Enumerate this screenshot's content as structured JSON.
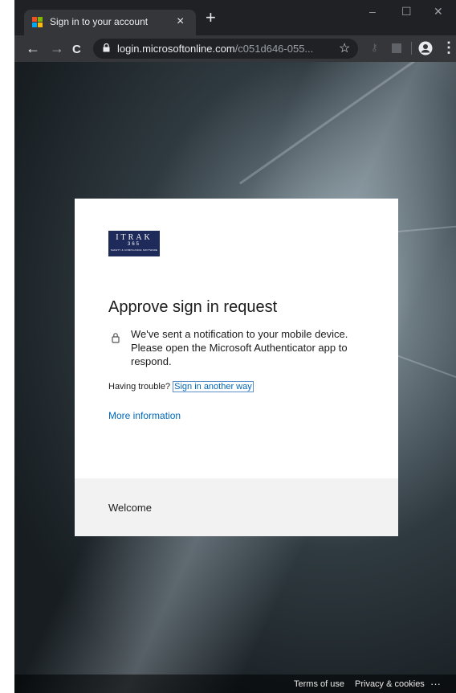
{
  "browser": {
    "tab_title": "Sign in to your account",
    "tab_close": "×",
    "new_tab": "+",
    "window_minimize": "–",
    "window_maximize": "☐",
    "window_close": "✕",
    "url_host": "login.microsoftonline.com",
    "url_path": "/c051d646-055...",
    "back": "←",
    "forward": "→",
    "reload": "C",
    "bookmark_star": "☆",
    "menu": "⋮"
  },
  "card": {
    "logo": {
      "line1": "ITRAK",
      "line2": "365",
      "line3": "SAFETY & COMPLIANCE SOFTWARE"
    },
    "heading": "Approve sign in request",
    "message": "We've sent a notification to your mobile device. Please open the Microsoft Authenticator app to respond.",
    "trouble_prefix": "Having trouble?",
    "trouble_link": "Sign in another way",
    "more_info": "More information",
    "footer_text": "Welcome"
  },
  "footer": {
    "terms": "Terms of use",
    "privacy": "Privacy & cookies",
    "more": "···"
  },
  "colors": {
    "link": "#0067b8",
    "chrome_dark": "#202124",
    "chrome_toolbar": "#35363a",
    "logo_bg": "#1d2a5a"
  }
}
